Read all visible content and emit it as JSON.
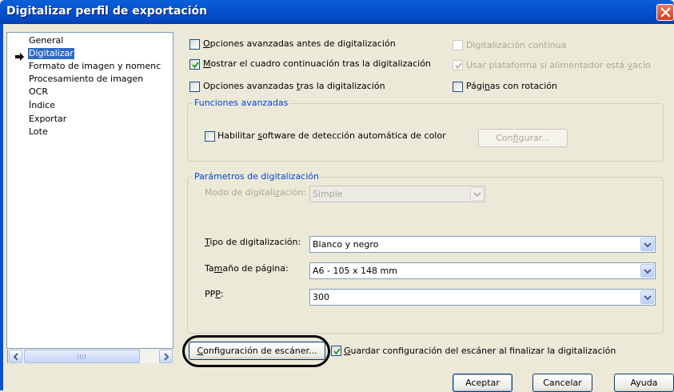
{
  "window": {
    "title": "Digitalizar perfil de exportación"
  },
  "tree": {
    "items": [
      {
        "label": "General"
      },
      {
        "label": "Digitalizar"
      },
      {
        "label": "Formato de imagen y nomenc"
      },
      {
        "label": "Procesamiento de imagen"
      },
      {
        "label": "OCR"
      },
      {
        "label": "Índice"
      },
      {
        "label": "Exportar"
      },
      {
        "label": "Lote"
      }
    ]
  },
  "options": {
    "advanced_before": {
      "pre": "",
      "u": "O",
      "post": "pciones avanzadas antes de digitalización",
      "checked": false
    },
    "continuation": {
      "pre": "",
      "u": "M",
      "post": "ostrar el cuadro continuación tras la digitalización",
      "checked": true
    },
    "advanced_after": {
      "pre": "Opciones avanzadas ",
      "u": "t",
      "post": "ras la digitalización",
      "checked": false
    },
    "continuous": {
      "pre": "Digitalización continua",
      "u": "",
      "post": "",
      "checked": false,
      "disabled": true
    },
    "platform": {
      "pre": "Usar plataforma si alimentador está ",
      "u": "v",
      "post": "acío",
      "checked": true,
      "disabled": true
    },
    "rotation": {
      "pre": "Pági",
      "u": "n",
      "post": "as con rotación",
      "checked": false
    }
  },
  "advanced_functions": {
    "title": "Funciones avanzadas",
    "color_detect": {
      "pre": "Habilitar ",
      "u": "s",
      "post": "oftware de detección automática de color",
      "checked": false
    },
    "configure_button": {
      "pre": "Con",
      "u": "f",
      "post": "igurar..."
    }
  },
  "scan_params": {
    "title": "Parámetros de digitalización",
    "mode": {
      "pre": "Modo de digitali",
      "u": "z",
      "post": "ación:",
      "value": "Simple"
    },
    "type": {
      "pre": "",
      "u": "T",
      "post": "ipo de digitalización:",
      "value": "Blanco y negro"
    },
    "size": {
      "pre": "Ta",
      "u": "m",
      "post": "año de página:",
      "value": "A6 - 105 x 148 mm"
    },
    "dpi": {
      "pre": "PP",
      "u": "P",
      "post": ":",
      "value": "300"
    }
  },
  "scanner_config_button": {
    "pre": "",
    "u": "C",
    "post": "onfiguración de escáner..."
  },
  "save_config": {
    "pre": "",
    "u": "G",
    "post": "uardar configuración del escáner al finalizar la digitalización",
    "checked": true
  },
  "buttons": {
    "accept": "Aceptar",
    "cancel": "Cancelar",
    "help": "Ayuda"
  },
  "colors": {
    "title_bar": "#0553d0",
    "selection": "#316ac5",
    "group_title": "#0046d5",
    "face": "#ece9d8",
    "check": "#21a121"
  },
  "icons": {
    "close": "close-icon",
    "tree_pointer": "arrow-right-icon",
    "combo_dropdown": "chevron-down-icon",
    "checkmark": "checkmark-icon"
  }
}
